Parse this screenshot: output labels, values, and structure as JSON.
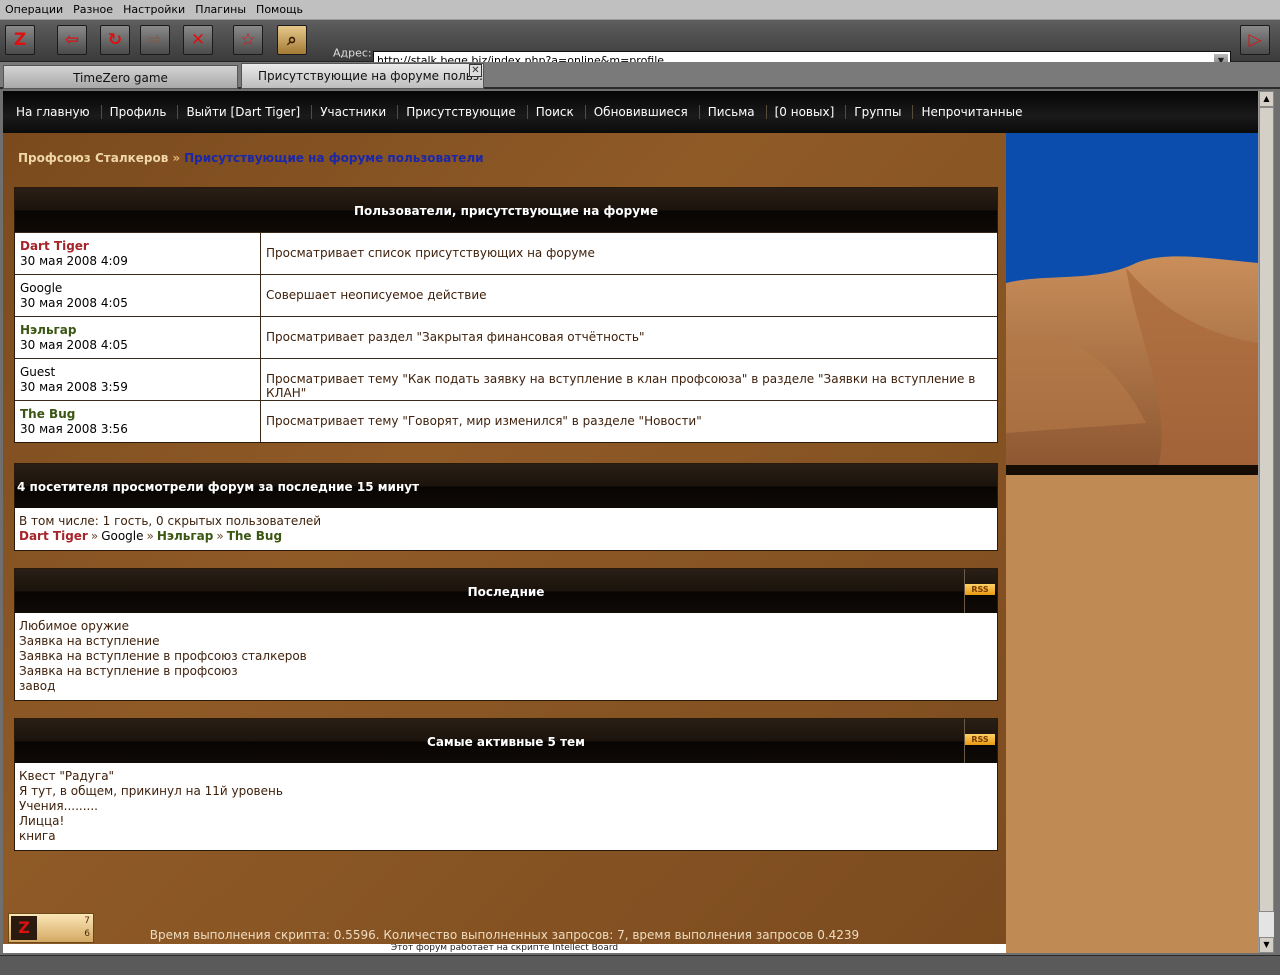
{
  "menu": [
    "Операции",
    "Разное",
    "Настройки",
    "Плагины",
    "Помощь"
  ],
  "toolbar": {
    "address_label": "Адрес:",
    "address_value": "http://stalk.bege.biz/index.php?a=online&m=profile",
    "logo_glyph": "Z"
  },
  "tabs": [
    "TimeZero game",
    "Присутствующие на форуме польз.."
  ],
  "nav": [
    "На главную",
    "Профиль",
    "Выйти [Dart Tiger]",
    "Участники",
    "Присутствующие",
    "Поиск",
    "Обновившиеся",
    "Письма",
    "[0 новых]",
    "Группы",
    "Непрочитанные"
  ],
  "breadcrumb": {
    "root": "Профсоюз Сталкеров",
    "sep": "»",
    "current": "Присутствующие на форуме пользователи"
  },
  "online_panel": {
    "title": "Пользователи, присутствующие на форуме",
    "rows": [
      {
        "name": "Dart Tiger",
        "time": "30 мая 2008 4:09",
        "action": "Просматривает список присутствующих на форуме",
        "role": "admin"
      },
      {
        "name": "Google",
        "time": "30 мая 2008 4:05",
        "action": "Совершает неописуемое действие",
        "role": "normal"
      },
      {
        "name": "Нэльгар",
        "time": "30 мая 2008 4:05",
        "action": "Просматривает раздел \"Закрытая финансовая отчётность\"",
        "role": "mod"
      },
      {
        "name": "Guest",
        "time": "30 мая 2008 3:59",
        "action": "Просматривает тему \"Как подать заявку на вступление в клан профсоюза\" в разделе \"Заявки на вступление в КЛАН\"",
        "role": "normal"
      },
      {
        "name": "The Bug",
        "time": "30 мая 2008 3:56",
        "action": "Просматривает тему \"Говорят, мир изменился\" в разделе \"Новости\"",
        "role": "mod"
      }
    ]
  },
  "stats_panel": {
    "title": "4 посетителя просмотрели форум за последние 15 минут",
    "summary": "В том числе: 1 гость, 0 скрытых пользователей",
    "sep": "»",
    "names": [
      {
        "name": "Dart Tiger",
        "role": "admin"
      },
      {
        "name": "Google",
        "role": "normal"
      },
      {
        "name": "Нэльгар",
        "role": "mod"
      },
      {
        "name": "The Bug",
        "role": "mod"
      }
    ]
  },
  "latest_panel": {
    "title": "Последние",
    "rss": "RSS",
    "items": [
      "Любимое оружие",
      "Заявка на вступление",
      "Заявка на вступление в профсоюз сталкеров",
      "Заявка на вступление в профсоюз",
      "завод"
    ]
  },
  "active_panel": {
    "title": "Самые активные 5 тем",
    "rss": "RSS",
    "items": [
      "Квест \"Радуга\"",
      "Я тут, в общем, прикинул на 11й уровень",
      "Учения.........",
      "Лицца!",
      "книга"
    ]
  },
  "footer": {
    "script_time": "Время выполнения скрипта: 0.5596. Количество выполненных запросов: 7, время выполнения запросов 0.4239",
    "counter_logo": "Z",
    "counter_top": "7",
    "counter_bottom": "6",
    "powered": "Этот форум работает на скрипте Intellect Board"
  },
  "colors": {
    "admin": "#a5252a",
    "mod": "#3b5613",
    "accent": "#c08a54"
  }
}
